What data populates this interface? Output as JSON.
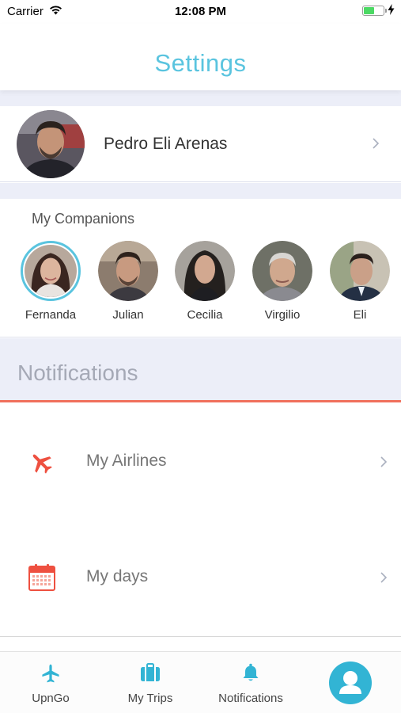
{
  "status_bar": {
    "carrier": "Carrier",
    "time": "12:08 PM",
    "battery_level": 0.55
  },
  "header": {
    "title": "Settings"
  },
  "profile": {
    "name": "Pedro Eli Arenas"
  },
  "companions": {
    "title": "My Companions",
    "selected_index": 0,
    "items": [
      {
        "name": "Fernanda"
      },
      {
        "name": "Julian"
      },
      {
        "name": "Cecilia"
      },
      {
        "name": "Virgilio"
      },
      {
        "name": "Eli"
      }
    ]
  },
  "notifications": {
    "title": "Notifications",
    "items": [
      {
        "label": "My Airlines",
        "icon": "airplane-icon"
      },
      {
        "label": "My days",
        "icon": "calendar-icon"
      }
    ]
  },
  "tabbar": {
    "items": [
      {
        "label": "UpnGo",
        "icon": "airplane-icon"
      },
      {
        "label": "My Trips",
        "icon": "suitcase-icon"
      },
      {
        "label": "Notifications",
        "icon": "bell-icon"
      },
      {
        "label": "",
        "icon": "user-icon"
      }
    ]
  },
  "colors": {
    "accent": "#5ac4df",
    "notification_rule": "#f0705c",
    "section_bg": "#eceef8",
    "tab_icon": "#32b4d4"
  }
}
